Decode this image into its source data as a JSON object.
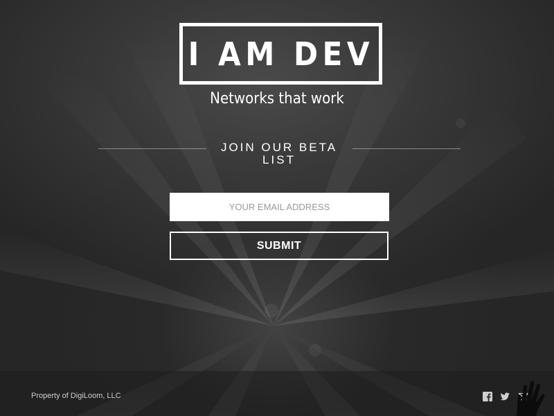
{
  "brand": {
    "logo_text": "I AM DEV",
    "tagline": "Networks that work"
  },
  "signup": {
    "heading": "JOIN OUR BETA LIST",
    "email_placeholder": "YOUR EMAIL ADDRESS",
    "email_value": "",
    "submit_label": "SUBMIT"
  },
  "footer": {
    "copyright": "Property of DigiLoom, LLC",
    "social_icons": [
      "facebook-icon",
      "twitter-icon",
      "email-icon"
    ]
  },
  "colors": {
    "background": "#333333",
    "text": "#ffffff",
    "input_background": "#ffffff",
    "placeholder": "#999999"
  }
}
